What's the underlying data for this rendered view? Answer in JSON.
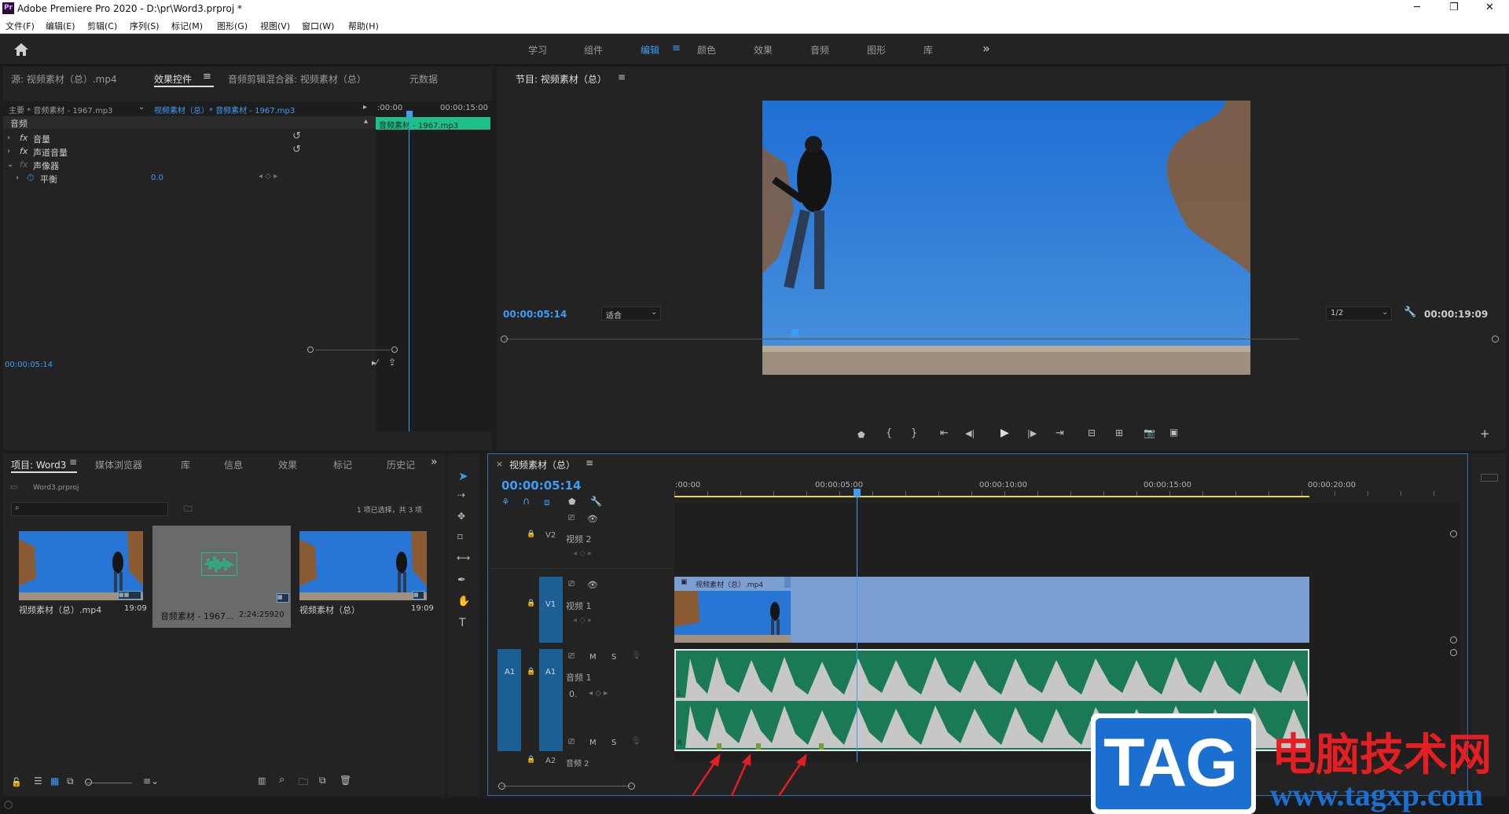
{
  "window": {
    "title": "Adobe Premiere Pro 2020 - D:\\pr\\Word3.prproj *",
    "minimize": "─",
    "maximize": "❐",
    "close": "✕"
  },
  "menu": [
    "文件(F)",
    "编辑(E)",
    "剪辑(C)",
    "序列(S)",
    "标记(M)",
    "图形(G)",
    "视图(V)",
    "窗口(W)",
    "帮助(H)"
  ],
  "workspaces": [
    "学习",
    "组件",
    "编辑",
    "颜色",
    "效果",
    "音频",
    "图形",
    "库"
  ],
  "workspace_active": "编辑",
  "workspace_more": "»",
  "source_panel": {
    "tabs": [
      "源: 视频素材（总）.mp4",
      "效果控件",
      "音频剪辑混合器: 视频素材（总）",
      "元数据"
    ],
    "active_tab": "效果控件",
    "master_label": "主要 * 音频素材 - 1967.mp3",
    "clip_label": "视频素材（总）* 音频素材 - 1967.mp3",
    "ruler_start": ":00:00",
    "ruler_end": "00:00:15:00",
    "clip_bar": "音频素材 - 1967.mp3",
    "section": "音频",
    "effects": [
      {
        "fx": "fx",
        "name": "音量"
      },
      {
        "fx": "fx",
        "name": "声道音量"
      },
      {
        "fx": "fx",
        "name": "声像器"
      }
    ],
    "param_name": "平衡",
    "param_value": "0.0",
    "timecode": "00:00:05:14"
  },
  "program": {
    "title": "节目: 视频素材（总）",
    "timecode": "00:00:05:14",
    "fit": "适合",
    "resolution": "1/2",
    "duration": "00:00:19:09"
  },
  "project": {
    "tabs": [
      "项目: Word3",
      "媒体浏览器",
      "库",
      "信息",
      "效果",
      "标记",
      "历史记"
    ],
    "active_tab": "项目: Word3",
    "file": "Word3.prproj",
    "selection": "1 项已选择，共 3 项",
    "items": [
      {
        "name": "视频素材（总）.mp4",
        "duration": "19:09"
      },
      {
        "name": "音频素材 - 1967...",
        "duration": "2:24:25920"
      },
      {
        "name": "视频素材（总）",
        "duration": "19:09"
      }
    ]
  },
  "timeline": {
    "title": "视频素材（总）",
    "timecode": "00:00:05:14",
    "ruler": [
      ":00:00",
      "00:00:05:00",
      "00:00:10:00",
      "00:00:15:00",
      "00:00:20:00"
    ],
    "tracks": {
      "v2": {
        "label": "V2",
        "name": "视频 2"
      },
      "v1": {
        "src": "V1",
        "label": "V1",
        "name": "视频 1"
      },
      "a1": {
        "src": "A1",
        "label": "A1",
        "name": "音频 1",
        "m": "M",
        "s": "S",
        "vol": "0."
      },
      "a2": {
        "label": "A2",
        "name": "音频 2",
        "m": "M",
        "s": "S"
      }
    },
    "video_clip": "视频素材（总）.mp4",
    "wave_ch": [
      "L",
      "R"
    ]
  },
  "watermark": {
    "tag": "TAG",
    "cn": "电脑技术网",
    "url": "www.tagxp.com"
  },
  "colors": {
    "accent": "#3d9df6",
    "audio_clip": "#1a7a55",
    "video_clip": "#7b9fd0",
    "tag_blue": "#1a6fd0",
    "tag_red": "#e41f23"
  }
}
